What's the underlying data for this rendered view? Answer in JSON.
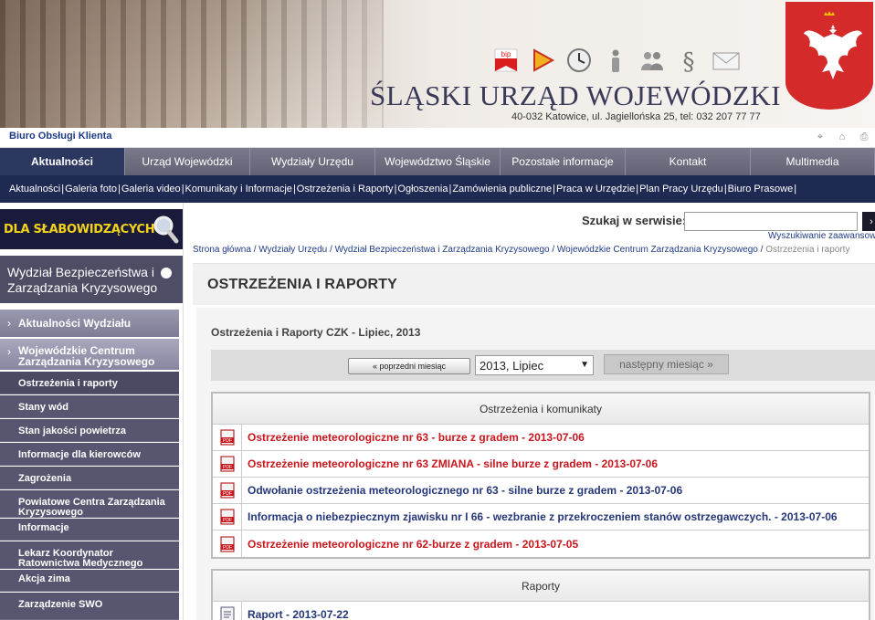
{
  "header": {
    "title": "ŚLĄSKI URZĄD WOJEWÓDZKI",
    "address": "40-032 Katowice, ul. Jagiellońska 25, tel: 032 207 77 77",
    "icons": [
      "bip-icon",
      "play-icon",
      "clock-icon",
      "info-icon",
      "users-icon",
      "paragraph-icon",
      "mail-icon"
    ],
    "bip_label": "bip",
    "emblem": "polish-eagle-emblem"
  },
  "topbar": {
    "link": "Biuro Obsługi Klienta",
    "tools": [
      "sitemap-icon",
      "home-icon",
      "print-icon"
    ]
  },
  "mainnav": [
    "Aktualności",
    "Urząd Wojewódzki",
    "Wydziały Urzędu",
    "Województwo Śląskie",
    "Pozostałe informacje",
    "Kontakt",
    "Multimedia"
  ],
  "subnav": [
    "Aktualności",
    "Galeria foto",
    "Galeria video",
    "Komunikaty i Informacje",
    "Ostrzeżenia i Raporty",
    "Ogłoszenia",
    "Zamówienia publiczne",
    "Praca w Urzędzie",
    "Plan Pracy Urzędu",
    "Biuro Prasowe"
  ],
  "sidebar": {
    "banner": "DLA SŁABOWIDZĄCYCH",
    "department": "Wydział Bezpieczeństwa i Zarządzania Kryzysowego",
    "main_items": [
      "Aktualności Wydziału",
      "Wojewódzkie Centrum Zarządzania Kryzysowego"
    ],
    "sub_items": [
      "Ostrzeżenia i raporty",
      "Stany wód",
      "Stan jakości powietrza",
      "Informacje dla kierowców",
      "Zagrożenia",
      "Powiatowe Centra Zarządzania Kryzysowego",
      "Informacje",
      "Lekarz Koordynator Ratownictwa Medycznego",
      "Akcja zima",
      "Zarządzenie SWO"
    ]
  },
  "search": {
    "label": "Szukaj w serwisie:",
    "value": "",
    "advanced": "Wyszukiwanie zaawansowane"
  },
  "breadcrumb": [
    "Strona główna",
    "Wydziały Urzędu",
    "Wydział Bezpieczeństwa i Zarządzania Kryzysowego",
    "Wojewódzkie Centrum Zarządzania Kryzysowego",
    "Ostrzeżenia i raporty"
  ],
  "main": {
    "title": "OSTRZEŻENIA I RAPORTY",
    "subtitle": "Ostrzeżenia i Raporty CZK - Lipiec, 2013",
    "prev_button": "« poprzedni miesiąc",
    "month_value": "2013, Lipiec",
    "next_button": "następny miesiąc »"
  },
  "warnings": {
    "header": "Ostrzeżenia i komunikaty",
    "rows": [
      {
        "text": "Ostrzeżenie meteorologiczne nr 63 - burze z gradem - 2013-07-06",
        "color": "#c8161d"
      },
      {
        "text": "Ostrzeżenie meteorologiczne nr 63 ZMIANA - silne burze z gradem - 2013-07-06",
        "color": "#c8161d"
      },
      {
        "text": "Odwołanie ostrzeżenia meteorologicznego nr 63 - silne burze z gradem - 2013-07-06",
        "color": "#253779"
      },
      {
        "text": "Informacja o niebezpiecznym zjawisku nr I 66 - wezbranie z przekroczeniem stanów ostrzegawczych. - 2013-07-06",
        "color": "#253779"
      },
      {
        "text": "Ostrzeżenie meteorologiczne nr 62-burze z gradem - 2013-07-05",
        "color": "#c8161d"
      }
    ]
  },
  "reports": {
    "header": "Raporty",
    "rows": [
      {
        "text": "Raport - 2013-07-22",
        "color": "#253779"
      }
    ]
  },
  "colors": {
    "nav_bg": "#6e6e80",
    "nav_active": "#2d3860",
    "subnav_bg": "#1f2a52",
    "link_red": "#c8161d",
    "link_blue": "#253779",
    "banner_yellow": "#f2d21a"
  }
}
